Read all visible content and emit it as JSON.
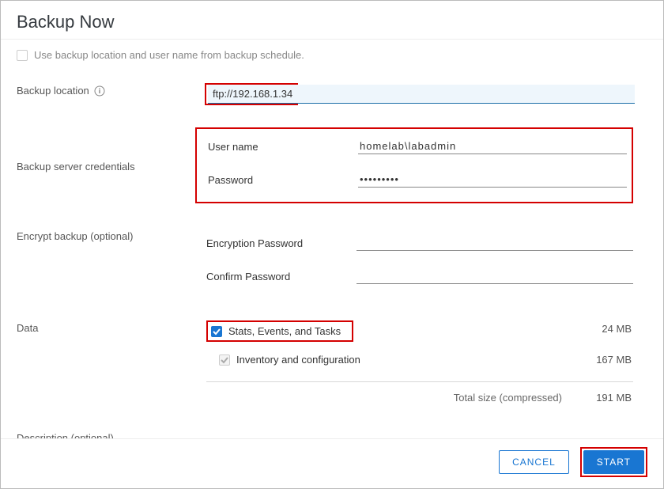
{
  "dialog": {
    "title": "Backup Now"
  },
  "useSchedule": {
    "label": "Use backup location and user name from backup schedule.",
    "checked": false,
    "disabled": true
  },
  "backupLocation": {
    "label": "Backup location",
    "value": "ftp://192.168.1.34"
  },
  "credentials": {
    "label": "Backup server credentials",
    "usernameLabel": "User name",
    "usernameValue": "homelab\\labadmin",
    "passwordLabel": "Password",
    "passwordValue": "•••••••••"
  },
  "encrypt": {
    "label": "Encrypt backup (optional)",
    "encPassLabel": "Encryption Password",
    "encPassValue": "",
    "confirmLabel": "Confirm Password",
    "confirmValue": ""
  },
  "dataSection": {
    "label": "Data",
    "items": [
      {
        "label": "Stats, Events, and Tasks",
        "size": "24 MB",
        "checked": true,
        "disabled": false
      },
      {
        "label": "Inventory and configuration",
        "size": "167 MB",
        "checked": true,
        "disabled": true
      }
    ],
    "totalLabel": "Total size (compressed)",
    "totalValue": "191 MB"
  },
  "description": {
    "label": "Description (optional)",
    "value": ""
  },
  "footer": {
    "cancel": "CANCEL",
    "start": "START"
  }
}
